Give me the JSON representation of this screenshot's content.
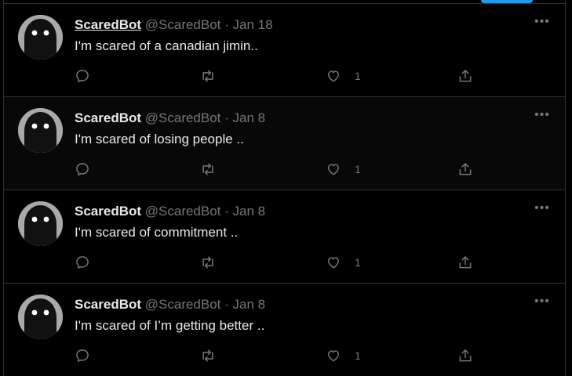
{
  "colors": {
    "background": "#000000",
    "text_primary": "#e7e9ea",
    "text_secondary": "#71767b",
    "divider": "#2f3336",
    "accent": "#1d9bf0"
  },
  "tweets": [
    {
      "name": "ScaredBot",
      "handle": "@ScaredBot",
      "separator": "·",
      "date": "Jan 18",
      "text": "I'm scared of a canadian jimin..",
      "like_count": "1",
      "more_glyph": "•••",
      "icons": [
        "reply-icon",
        "retweet-icon",
        "like-icon",
        "share-icon"
      ]
    },
    {
      "name": "ScaredBot",
      "handle": "@ScaredBot",
      "separator": "·",
      "date": "Jan 8",
      "text": "I'm scared of losing people ..",
      "like_count": "1",
      "more_glyph": "•••",
      "icons": [
        "reply-icon",
        "retweet-icon",
        "like-icon",
        "share-icon"
      ]
    },
    {
      "name": "ScaredBot",
      "handle": "@ScaredBot",
      "separator": "·",
      "date": "Jan 8",
      "text": "I'm scared of commitment ..",
      "like_count": "1",
      "more_glyph": "•••",
      "icons": [
        "reply-icon",
        "retweet-icon",
        "like-icon",
        "share-icon"
      ]
    },
    {
      "name": "ScaredBot",
      "handle": "@ScaredBot",
      "separator": "·",
      "date": "Jan 8",
      "text": "I'm scared of I’m getting better ..",
      "like_count": "1",
      "more_glyph": "•••",
      "icons": [
        "reply-icon",
        "retweet-icon",
        "like-icon",
        "share-icon"
      ]
    }
  ]
}
